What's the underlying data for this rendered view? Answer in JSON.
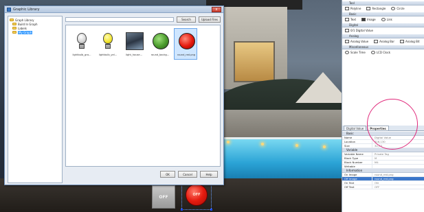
{
  "dialog": {
    "title": "Graphic Library",
    "close_label": "x",
    "tree": [
      {
        "label": "Graph Library",
        "indent": false,
        "selected": false
      },
      {
        "label": "Build In Graph",
        "indent": true,
        "selected": false
      },
      {
        "label": "Labels",
        "indent": true,
        "selected": false
      },
      {
        "label": "My Graph",
        "indent": true,
        "selected": true
      }
    ],
    "search_value": "",
    "search_label": "Search",
    "upload_label": "Upload Files",
    "thumbnails": [
      {
        "caption": "lightbulb_gra...",
        "kind": "bulb-grey",
        "selected": false
      },
      {
        "caption": "lightbulb_yel...",
        "kind": "bulb-yellow",
        "selected": false
      },
      {
        "caption": "light_house...",
        "kind": "photo",
        "selected": false
      },
      {
        "caption": "round_backg...",
        "kind": "ball-green",
        "selected": false
      },
      {
        "caption": "round_red.png",
        "kind": "ball-red",
        "selected": true
      }
    ],
    "ok_label": "OK",
    "cancel_label": "Cancel",
    "help_label": "Help"
  },
  "canvas": {
    "off_button_label": "OFF",
    "off_lamp_label": "OFF"
  },
  "toolbox": {
    "sections": [
      {
        "header": "Tool",
        "rows": [
          [
            {
              "label": "Polyline",
              "icon": "polyline-icon",
              "shape": "box"
            },
            {
              "label": "Rectangle",
              "icon": "rectangle-icon",
              "shape": "box"
            },
            {
              "label": "Circle",
              "icon": "circle-icon",
              "shape": "round"
            }
          ]
        ]
      },
      {
        "header": "Basic",
        "rows": [
          [
            {
              "label": "Text",
              "icon": "text-icon",
              "shape": "box"
            },
            {
              "label": "Image",
              "icon": "image-icon",
              "shape": "dark"
            },
            {
              "label": "Link",
              "icon": "link-icon",
              "shape": "round"
            }
          ]
        ]
      },
      {
        "header": "Digital",
        "rows": [
          [
            {
              "label": "0/1 Digital Value",
              "icon": "digital-value-icon",
              "shape": "box"
            }
          ]
        ]
      },
      {
        "header": "Analog",
        "rows": [
          [
            {
              "label": "Analog Value",
              "icon": "analog-value-icon",
              "shape": "box"
            },
            {
              "label": "Analog Bar",
              "icon": "analog-bar-icon",
              "shape": "box"
            },
            {
              "label": "Analog Bit",
              "icon": "analog-bit-icon",
              "shape": "box"
            }
          ]
        ]
      },
      {
        "header": "Miscellaneous",
        "rows": [
          [
            {
              "label": "Scale Time",
              "icon": "scale-time-icon",
              "shape": "round"
            },
            {
              "label": "LCD Clock",
              "icon": "clock-icon",
              "shape": "round"
            }
          ]
        ]
      }
    ]
  },
  "tabs": [
    {
      "label": "Digital Value",
      "active": false
    },
    {
      "label": "Properties",
      "active": true
    }
  ],
  "properties": [
    {
      "type": "group",
      "label": "Basic"
    },
    {
      "type": "row",
      "key": "Name",
      "value": "Digital Value"
    },
    {
      "type": "row",
      "key": "Location",
      "value": "316,130"
    },
    {
      "type": "row",
      "key": "Size",
      "value": "32,33"
    },
    {
      "type": "group",
      "label": "Variable"
    },
    {
      "type": "row",
      "key": "Variable Name",
      "value": "Private Tag"
    },
    {
      "type": "row",
      "key": "Block Type",
      "value": "M"
    },
    {
      "type": "row",
      "key": "Block Number",
      "value": "M4"
    },
    {
      "type": "row",
      "key": "Writable",
      "value": ""
    },
    {
      "type": "group",
      "label": "Information"
    },
    {
      "type": "row",
      "key": "On Image",
      "value": "round_red.png"
    },
    {
      "type": "row",
      "key": "Off Image",
      "value": "round_red.png",
      "selected": true
    },
    {
      "type": "row",
      "key": "On Text",
      "value": "ON"
    },
    {
      "type": "row",
      "key": "Off Text",
      "value": "OFF"
    }
  ]
}
